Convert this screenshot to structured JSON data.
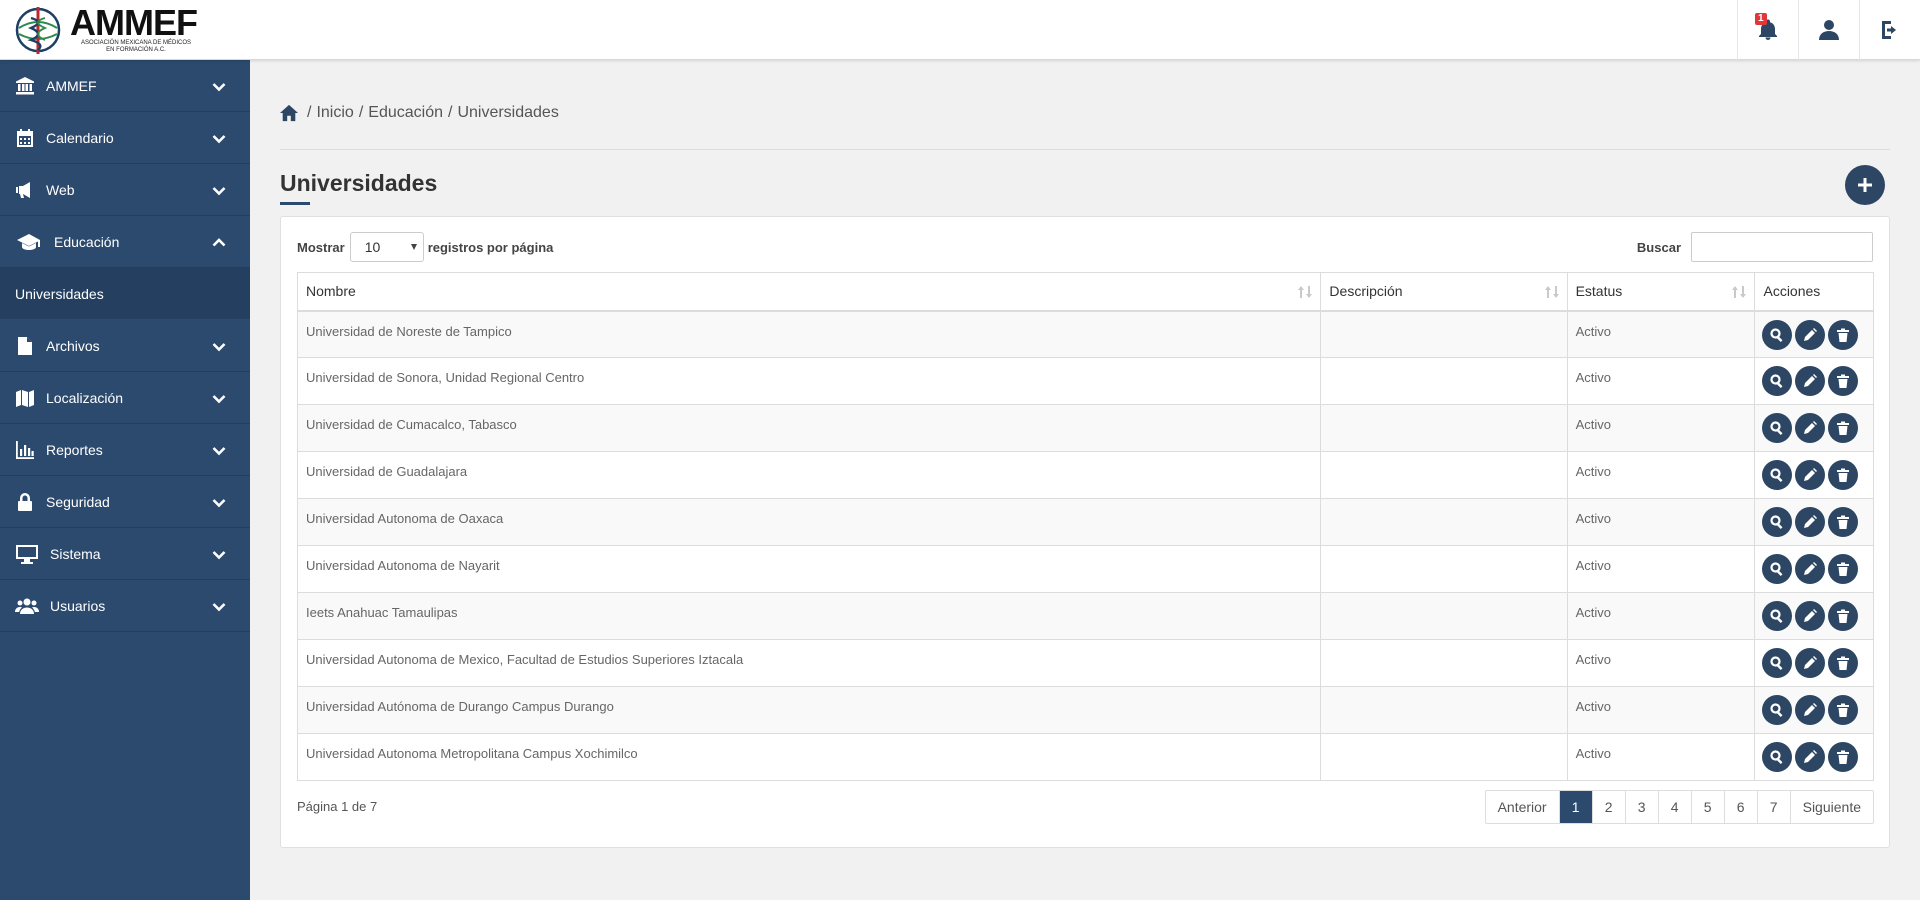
{
  "header": {
    "logo_title": "AMMEF",
    "logo_subtitle": "ASOCIACIÓN MEXICANA DE MÉDICOS EN FORMACIÓN A.C.",
    "notification_count": "1",
    "icons": [
      "bell-icon",
      "user-icon",
      "logout-icon"
    ]
  },
  "sidebar": {
    "items": [
      {
        "label": "AMMEF",
        "icon": "bank-icon",
        "expanded": false
      },
      {
        "label": "Calendario",
        "icon": "calendar-icon",
        "expanded": false
      },
      {
        "label": "Web",
        "icon": "megaphone-icon",
        "expanded": false
      },
      {
        "label": "Educación",
        "icon": "graduation-cap-icon",
        "expanded": true
      },
      {
        "label": "Archivos",
        "icon": "file-icon",
        "expanded": false
      },
      {
        "label": "Localización",
        "icon": "map-icon",
        "expanded": false
      },
      {
        "label": "Reportes",
        "icon": "bar-chart-icon",
        "expanded": false
      },
      {
        "label": "Seguridad",
        "icon": "lock-icon",
        "expanded": false
      },
      {
        "label": "Sistema",
        "icon": "monitor-icon",
        "expanded": false
      },
      {
        "label": "Usuarios",
        "icon": "users-icon",
        "expanded": false
      }
    ],
    "subitem": "Universidades"
  },
  "breadcrumb": [
    "Inicio",
    "Educación",
    "Universidades"
  ],
  "page": {
    "title": "Universidades",
    "show_label": "Mostrar",
    "page_size": "10",
    "per_page_label": "registros por página",
    "search_label": "Buscar",
    "search_value": ""
  },
  "table": {
    "columns": [
      "Nombre",
      "Descripción",
      "Estatus",
      "Acciones"
    ],
    "rows": [
      {
        "nombre": "Universidad de Noreste de Tampico",
        "descripcion": "",
        "estatus": "Activo"
      },
      {
        "nombre": "Universidad de Sonora, Unidad Regional Centro",
        "descripcion": "",
        "estatus": "Activo"
      },
      {
        "nombre": "Universidad de Cumacalco, Tabasco",
        "descripcion": "",
        "estatus": "Activo"
      },
      {
        "nombre": "Universidad de Guadalajara",
        "descripcion": "",
        "estatus": "Activo"
      },
      {
        "nombre": "Universidad Autonoma de Oaxaca",
        "descripcion": "",
        "estatus": "Activo"
      },
      {
        "nombre": "Universidad Autonoma de Nayarit",
        "descripcion": "",
        "estatus": "Activo"
      },
      {
        "nombre": "Ieets Anahuac Tamaulipas",
        "descripcion": "",
        "estatus": "Activo"
      },
      {
        "nombre": "Universidad Autonoma de Mexico, Facultad de Estudios Superiores Iztacala",
        "descripcion": "",
        "estatus": "Activo"
      },
      {
        "nombre": "Universidad Autónoma de Durango Campus Durango",
        "descripcion": "",
        "estatus": "Activo"
      },
      {
        "nombre": "Universidad Autonoma Metropolitana Campus Xochimilco",
        "descripcion": "",
        "estatus": "Activo"
      }
    ]
  },
  "pagination": {
    "info": "Página 1 de 7",
    "prev": "Anterior",
    "next": "Siguiente",
    "pages": [
      "1",
      "2",
      "3",
      "4",
      "5",
      "6",
      "7"
    ],
    "current": "1"
  },
  "colors": {
    "sidebar": "#2c4a6e",
    "accent": "#2c4664",
    "badge": "#e2373a"
  }
}
